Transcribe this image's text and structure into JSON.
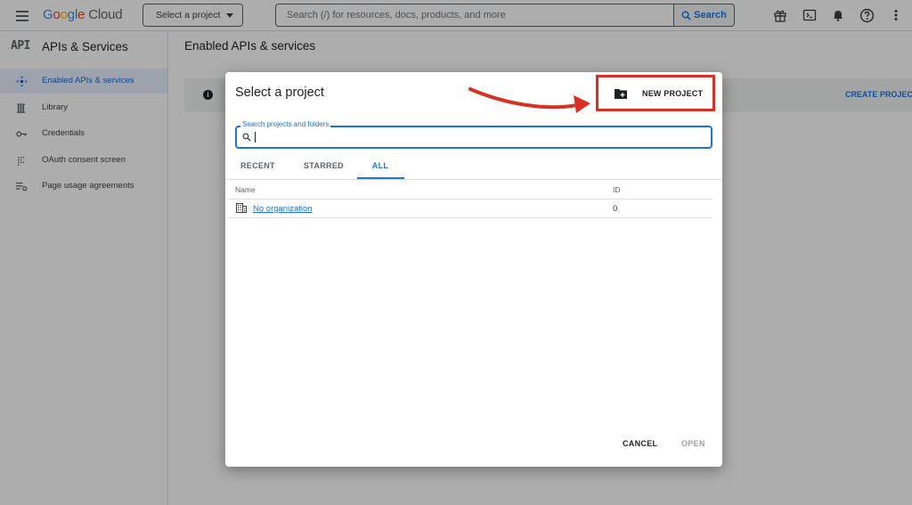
{
  "header": {
    "logo": {
      "g1": "G",
      "o1": "o",
      "o2": "o",
      "g2": "g",
      "l": "l",
      "e": "e",
      "cloud": "Cloud"
    },
    "project_picker": "Select a project",
    "search_placeholder": "Search (/) for resources, docs, products, and more",
    "search_button": "Search",
    "icons": [
      "gift-icon",
      "cloud-shell-icon",
      "bell-icon",
      "help-icon",
      "more-vert-icon"
    ]
  },
  "sidebar": {
    "mark": "API",
    "title": "APIs & Services",
    "items": [
      {
        "label": "Enabled APIs & services",
        "icon": "diamond-move-icon",
        "active": true
      },
      {
        "label": "Library",
        "icon": "library-icon",
        "active": false
      },
      {
        "label": "Credentials",
        "icon": "key-icon",
        "active": false
      },
      {
        "label": "OAuth consent screen",
        "icon": "consent-icon",
        "active": false
      },
      {
        "label": "Page usage agreements",
        "icon": "settings-list-icon",
        "active": false
      }
    ]
  },
  "main": {
    "title": "Enabled APIs & services",
    "info_icon": "i",
    "create_project_link": "CREATE PROJECT"
  },
  "dialog": {
    "title": "Select a project",
    "new_project_button": "NEW PROJECT",
    "search_label": "Search projects and folders",
    "tabs": [
      {
        "label": "RECENT",
        "active": false
      },
      {
        "label": "STARRED",
        "active": false
      },
      {
        "label": "ALL",
        "active": true
      }
    ],
    "columns": {
      "name": "Name",
      "id": "ID"
    },
    "rows": [
      {
        "name": "No organization",
        "id": "0"
      }
    ],
    "cancel_button": "CANCEL",
    "open_button": "OPEN"
  },
  "colors": {
    "accent": "#1a73e8",
    "annotation": "#d93025",
    "active_nav_bg": "#e8f0fe"
  }
}
